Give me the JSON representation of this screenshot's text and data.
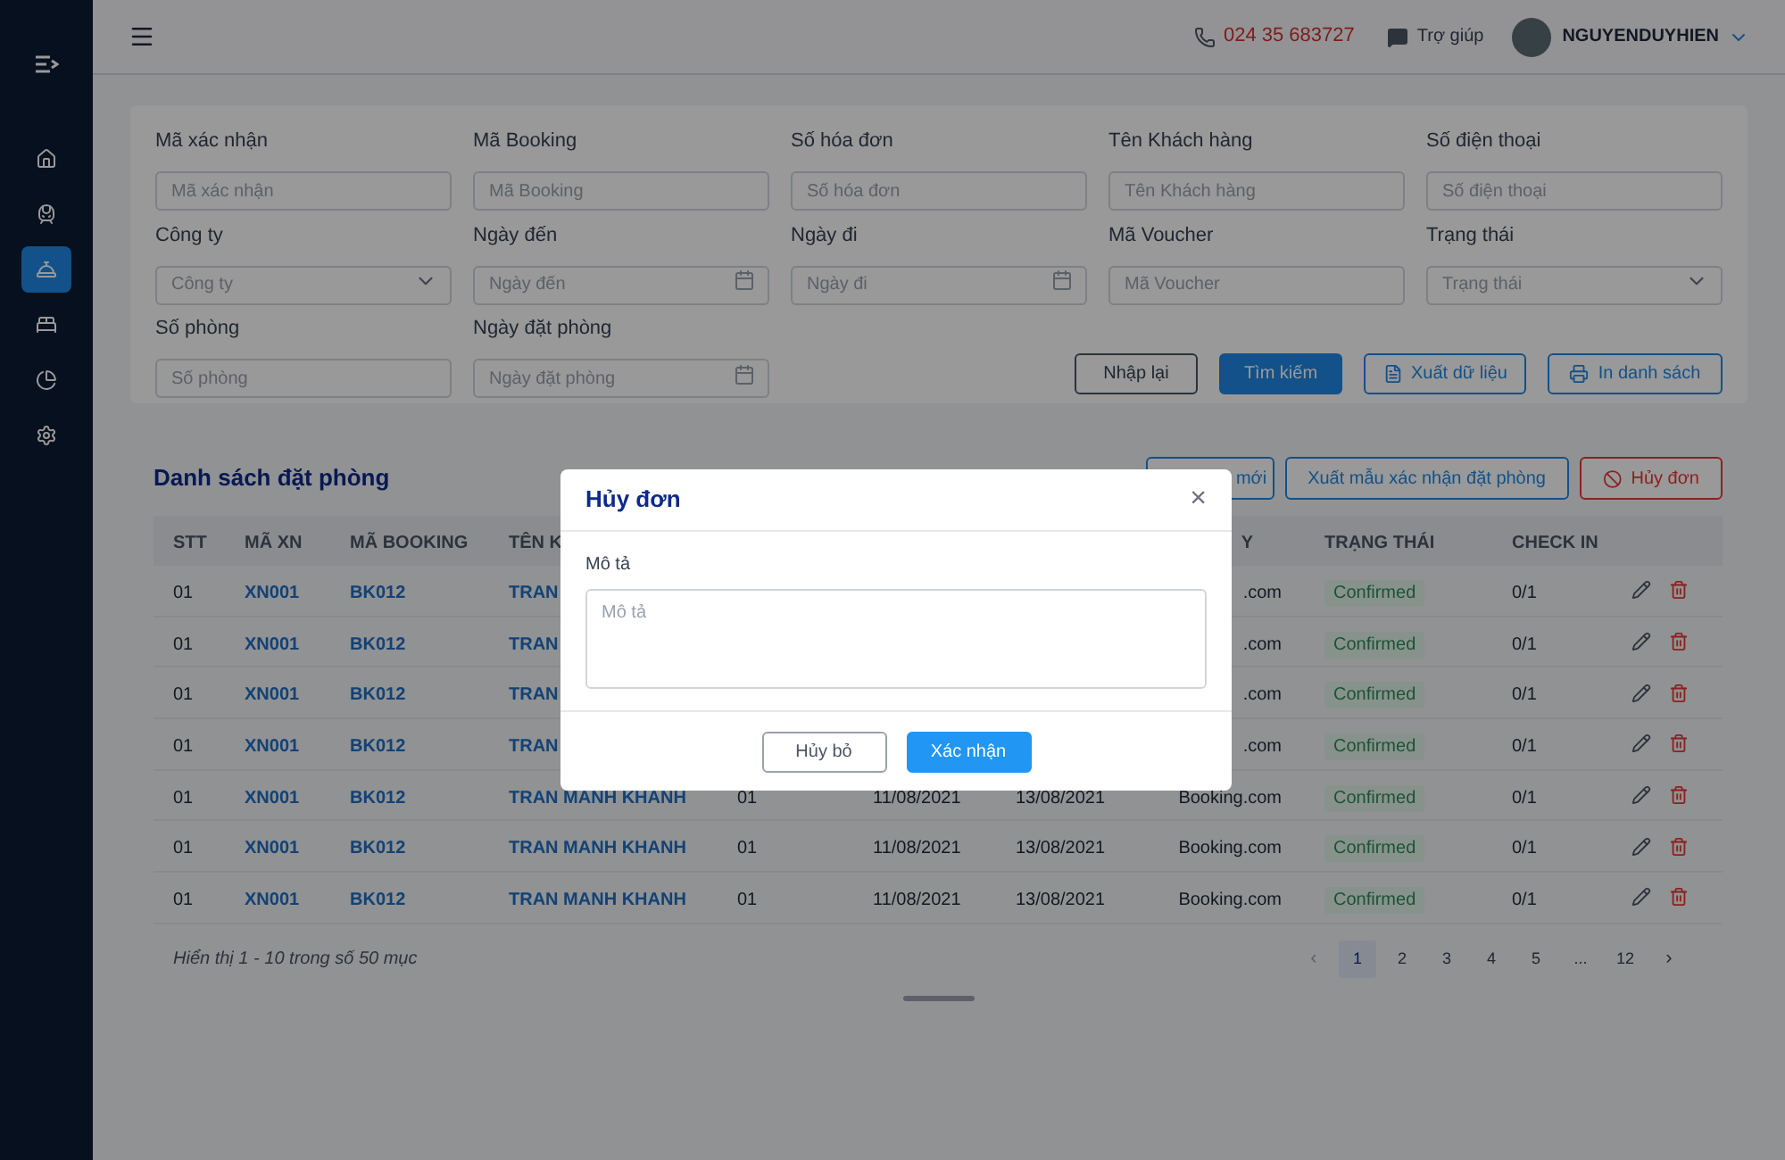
{
  "sidebar": {
    "items": [
      {
        "selected": false
      },
      {
        "selected": false
      },
      {
        "selected": true
      },
      {
        "selected": false
      },
      {
        "selected": false
      },
      {
        "selected": false
      }
    ]
  },
  "header": {
    "phone": "024 35 683727",
    "help": "Trợ giúp",
    "user": "NGUYENDUYHIEN"
  },
  "filters": [
    {
      "label": "Mã xác nhận",
      "placeholder": "Mã xác nhận",
      "kind": "text"
    },
    {
      "label": "Mã Booking",
      "placeholder": "Mã Booking",
      "kind": "text"
    },
    {
      "label": "Số hóa đơn",
      "placeholder": "Số hóa đơn",
      "kind": "text"
    },
    {
      "label": "Tên Khách hàng",
      "placeholder": "Tên Khách hàng",
      "kind": "text"
    },
    {
      "label": "Số điện thoại",
      "placeholder": "Số điện thoại",
      "kind": "text"
    },
    {
      "label": "Công ty",
      "placeholder": "Công ty",
      "kind": "select"
    },
    {
      "label": "Ngày đến",
      "placeholder": "Ngày đến",
      "kind": "date"
    },
    {
      "label": "Ngày đi",
      "placeholder": "Ngày đi",
      "kind": "date"
    },
    {
      "label": "Mã Voucher",
      "placeholder": "Mã Voucher",
      "kind": "text"
    },
    {
      "label": "Trạng thái",
      "placeholder": "Trạng thái",
      "kind": "select"
    },
    {
      "label": "Số phòng",
      "placeholder": "Số phòng",
      "kind": "text"
    },
    {
      "label": "Ngày đặt phòng",
      "placeholder": "Ngày đặt phòng",
      "kind": "date"
    }
  ],
  "filter_buttons": [
    {
      "label": "Nhập lại",
      "kind": "reset"
    },
    {
      "label": "Tìm kiếm",
      "kind": "primary"
    },
    {
      "label": "Xuất dữ liệu",
      "kind": "export"
    },
    {
      "label": "In danh sách",
      "kind": "print"
    }
  ],
  "list": {
    "title": "Danh sách đặt phòng",
    "buttons": [
      {
        "label": "mới",
        "kind": "add"
      },
      {
        "label": "Xuất mẫu xác nhận đặt phòng",
        "kind": "template"
      },
      {
        "label": "Hủy đơn",
        "kind": "cancel"
      }
    ],
    "columns": [
      "STT",
      "MÃ XN",
      "MÃ BOOKING",
      "TÊN K",
      "",
      "",
      "",
      "Y",
      "TRẠNG THÁI",
      "CHECK IN"
    ],
    "rows": [
      {
        "cells": [
          "01",
          "XN001",
          "BK012",
          "TRAN",
          "",
          "",
          "",
          ".com"
        ],
        "status": "Confirmed",
        "check_in": "0/1"
      },
      {
        "cells": [
          "01",
          "XN001",
          "BK012",
          "TRAN",
          "",
          "",
          "",
          ".com"
        ],
        "status": "Confirmed",
        "check_in": "0/1"
      },
      {
        "cells": [
          "01",
          "XN001",
          "BK012",
          "TRAN",
          "",
          "",
          "",
          ".com"
        ],
        "status": "Confirmed",
        "check_in": "0/1"
      },
      {
        "cells": [
          "01",
          "XN001",
          "BK012",
          "TRAN",
          "",
          "",
          "",
          ".com"
        ],
        "status": "Confirmed",
        "check_in": "0/1"
      },
      {
        "cells": [
          "01",
          "XN001",
          "BK012",
          "TRAN MANH KHANH",
          "01",
          "11/08/2021",
          "13/08/2021",
          "Booking.com"
        ],
        "status": "Confirmed",
        "check_in": "0/1"
      },
      {
        "cells": [
          "01",
          "XN001",
          "BK012",
          "TRAN MANH KHANH",
          "01",
          "11/08/2021",
          "13/08/2021",
          "Booking.com"
        ],
        "status": "Confirmed",
        "check_in": "0/1"
      },
      {
        "cells": [
          "01",
          "XN001",
          "BK012",
          "TRAN MANH KHANH",
          "01",
          "11/08/2021",
          "13/08/2021",
          "Booking.com"
        ],
        "status": "Confirmed",
        "check_in": "0/1"
      }
    ],
    "summary": "Hiển thị 1 - 10 trong số 50 mục",
    "pagination": {
      "prev": "‹",
      "next": "›",
      "pages": [
        {
          "label": "1",
          "selected": true
        },
        {
          "label": "2",
          "selected": false
        },
        {
          "label": "3",
          "selected": false
        },
        {
          "label": "4",
          "selected": false
        },
        {
          "label": "5",
          "selected": false
        },
        {
          "label": "...",
          "selected": false
        },
        {
          "label": "12",
          "selected": false
        }
      ]
    }
  },
  "dialog": {
    "title": "Hủy đơn",
    "close": "×",
    "field_label": "Mô tả",
    "placeholder": "Mô tả",
    "buttons": [
      {
        "label": "Hủy bỏ",
        "kind": "secondary"
      },
      {
        "label": "Xác nhận",
        "kind": "primary"
      }
    ]
  }
}
